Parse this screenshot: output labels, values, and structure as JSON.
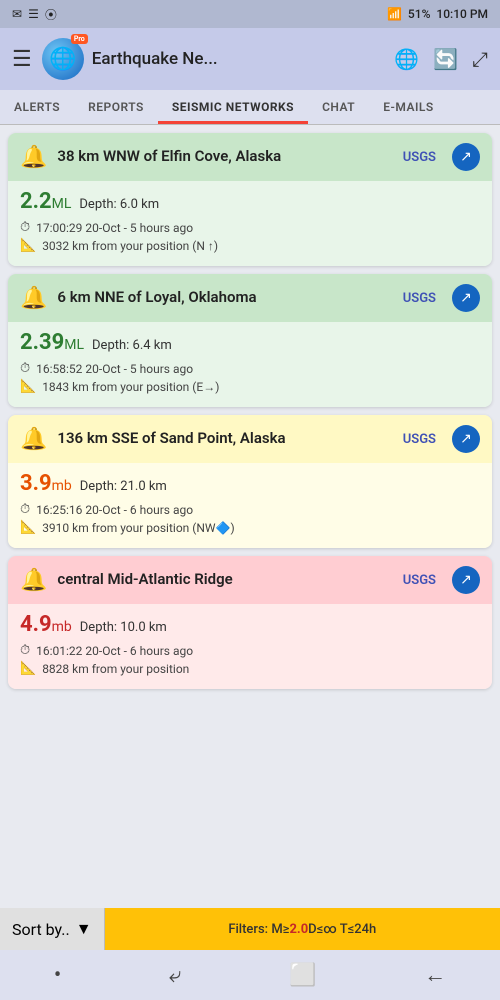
{
  "statusBar": {
    "left": [
      "✉",
      "☰",
      "⦿"
    ],
    "battery": "51%",
    "time": "10:10 PM",
    "signal": "📶"
  },
  "header": {
    "title": "Earthquake Ne...",
    "proLabel": "Pro"
  },
  "tabs": [
    {
      "id": "alerts",
      "label": "ALERTS",
      "active": false
    },
    {
      "id": "reports",
      "label": "REPORTS",
      "active": false
    },
    {
      "id": "seismic",
      "label": "SEISMIC NETWORKS",
      "active": true
    },
    {
      "id": "chat",
      "label": "CHAT",
      "active": false
    },
    {
      "id": "emails",
      "label": "E-MAILS",
      "active": false
    }
  ],
  "earthquakes": [
    {
      "id": "eq1",
      "location": "38 km WNW of Elfin Cove, Alaska",
      "source": "USGS",
      "magnitude": "2.2",
      "magType": "ML",
      "depth": "Depth: 6.0 km",
      "time": "17:00:29 20-Oct - 5 hours ago",
      "distance": "3032 km from your position (N ↑)",
      "colorClass": "green",
      "magColorClass": "mag-green"
    },
    {
      "id": "eq2",
      "location": "6 km NNE of Loyal, Oklahoma",
      "source": "USGS",
      "magnitude": "2.39",
      "magType": "ML",
      "depth": "Depth: 6.4 km",
      "time": "16:58:52 20-Oct - 5 hours ago",
      "distance": "1843 km from your position (E→)",
      "colorClass": "green",
      "magColorClass": "mag-green"
    },
    {
      "id": "eq3",
      "location": "136 km SSE of Sand Point, Alaska",
      "source": "USGS",
      "magnitude": "3.9",
      "magType": "mb",
      "depth": "Depth: 21.0 km",
      "time": "16:25:16 20-Oct - 6 hours ago",
      "distance": "3910 km from your position (NW🔷)",
      "colorClass": "yellow",
      "magColorClass": "mag-orange"
    },
    {
      "id": "eq4",
      "location": "central Mid-Atlantic Ridge",
      "source": "USGS",
      "magnitude": "4.9",
      "magType": "mb",
      "depth": "Depth: 10.0 km",
      "time": "16:01:22 20-Oct - 6 hours ago",
      "distance": "8828 km from your position",
      "colorClass": "red",
      "magColorClass": "mag-red"
    }
  ],
  "sortBar": {
    "label": "Sort by..",
    "arrow": "▼"
  },
  "filterBar": {
    "prefix": "Filters: M≥",
    "magValue": "2.0",
    "suffix": " D≤∞ T≤24h"
  },
  "navBar": {
    "icons": [
      "•",
      "⤶",
      "⬜",
      "←"
    ]
  }
}
